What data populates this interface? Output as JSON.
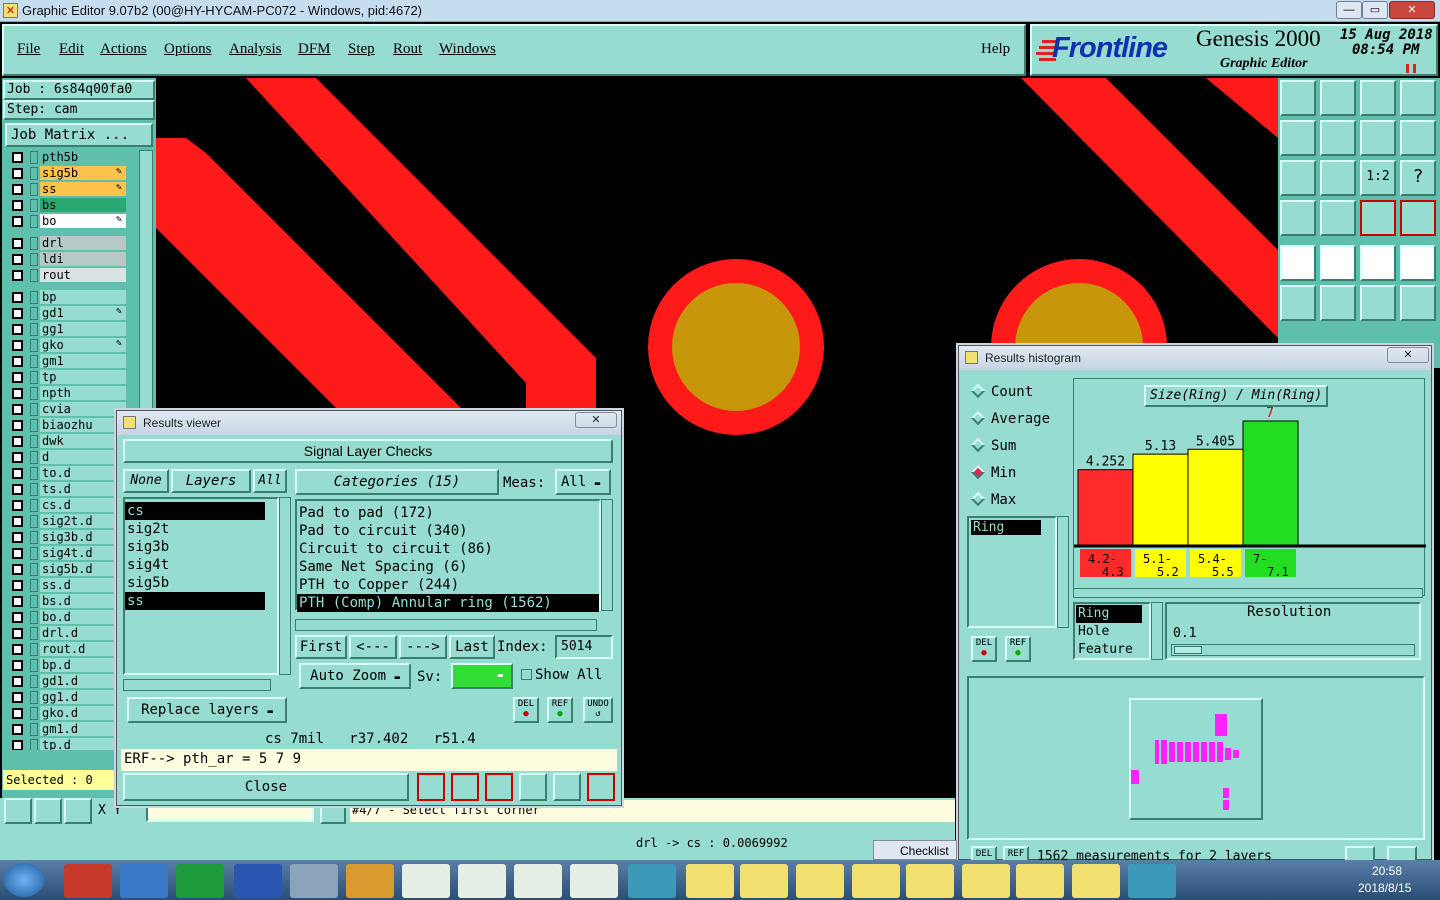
{
  "window": {
    "title": "Graphic Editor 9.07b2 (00@HY-HYCAM-PC072 - Windows, pid:4672)",
    "min": "—",
    "max": "▭",
    "close": "✕"
  },
  "menu": {
    "items": [
      "File",
      "Edit",
      "Actions",
      "Options",
      "Analysis",
      "DFM",
      "Step",
      "Rout",
      "Windows"
    ],
    "help": "Help"
  },
  "logo": {
    "brand": "Frontline",
    "product": "Genesis 2000",
    "subtitle": "Graphic Editor",
    "date": "15 Aug 2018",
    "time": "08:54 PM"
  },
  "job": {
    "job_label": "Job  :  6s84q00fa0",
    "step_label": "Step:  cam",
    "matrix_button": "Job Matrix ..."
  },
  "layers": [
    {
      "name": "pth5b",
      "color": "#5fbfad"
    },
    {
      "name": "sig5b",
      "color": "#ffc34d",
      "mark": "✎"
    },
    {
      "name": "ss",
      "color": "#ffc34d",
      "mark": "✎"
    },
    {
      "name": "bs",
      "color": "#2aa872"
    },
    {
      "name": "bo",
      "color": "#ffffff",
      "mark": "✎"
    },
    {
      "name": "drl",
      "color": "#b7c9c6"
    },
    {
      "name": "ldi",
      "color": "#b7c9c6"
    },
    {
      "name": "rout",
      "color": "#d9e3e1"
    },
    {
      "name": "bp",
      "color": "#96dcd0"
    },
    {
      "name": "gd1",
      "color": "#96dcd0",
      "mark": "✎"
    },
    {
      "name": "gg1",
      "color": "#96dcd0"
    },
    {
      "name": "gko",
      "color": "#96dcd0",
      "mark": "✎"
    },
    {
      "name": "gm1",
      "color": "#96dcd0"
    },
    {
      "name": "tp",
      "color": "#96dcd0"
    },
    {
      "name": "npth",
      "color": "#96dcd0"
    },
    {
      "name": "cvia",
      "color": "#96dcd0"
    },
    {
      "name": "biaozhu",
      "color": "#96dcd0"
    },
    {
      "name": "dwk",
      "color": "#96dcd0"
    },
    {
      "name": "d",
      "color": "#96dcd0"
    },
    {
      "name": "to.d",
      "color": "#96dcd0"
    },
    {
      "name": "ts.d",
      "color": "#96dcd0"
    },
    {
      "name": "cs.d",
      "color": "#96dcd0"
    },
    {
      "name": "sig2t.d",
      "color": "#96dcd0"
    },
    {
      "name": "sig3b.d",
      "color": "#96dcd0"
    },
    {
      "name": "sig4t.d",
      "color": "#96dcd0"
    },
    {
      "name": "sig5b.d",
      "color": "#96dcd0"
    },
    {
      "name": "ss.d",
      "color": "#96dcd0"
    },
    {
      "name": "bs.d",
      "color": "#96dcd0"
    },
    {
      "name": "bo.d",
      "color": "#96dcd0"
    },
    {
      "name": "drl.d",
      "color": "#96dcd0"
    },
    {
      "name": "rout.d",
      "color": "#96dcd0"
    },
    {
      "name": "bp.d",
      "color": "#96dcd0"
    },
    {
      "name": "gd1.d",
      "color": "#96dcd0"
    },
    {
      "name": "gg1.d",
      "color": "#96dcd0"
    },
    {
      "name": "gko.d",
      "color": "#96dcd0"
    },
    {
      "name": "gm1.d",
      "color": "#96dcd0"
    },
    {
      "name": "tp.d",
      "color": "#96dcd0"
    }
  ],
  "selected": "Selected : 0",
  "status": {
    "xy": "X Y",
    "prompt": "#4/7 - Select first corner",
    "measure": "drl -> cs : 0.0069992"
  },
  "results_viewer": {
    "title": "Results viewer",
    "header": "Signal Layer Checks",
    "none": "None",
    "layers": "Layers",
    "all": "All",
    "categories": "Categories (15)",
    "meas_label": "Meas:",
    "meas_value": "All",
    "layer_list": [
      "cs",
      "sig2t",
      "sig3b",
      "sig4t",
      "sig5b",
      "ss"
    ],
    "category_list": [
      "Pad to pad (172)",
      "Pad to circuit (340)",
      "Circuit to circuit (86)",
      "Same Net Spacing (6)",
      "PTH to Copper (244)",
      "PTH (Comp) Annular ring (1562)"
    ],
    "first": "First",
    "prev": "<---",
    "next": "--->",
    "last": "Last",
    "index_label": "Index:",
    "index_value": "5014",
    "auto_zoom": "Auto Zoom",
    "sv_label": "Sv:",
    "show_all": "Show All",
    "replace_layers": "Replace layers",
    "del": "DEL",
    "ref": "REF",
    "undo": "UNDO",
    "info": "cs 7mil   r37.402   r51.4",
    "erf": "ERF--> pth_ar = 5 7 9",
    "close": "Close"
  },
  "histogram": {
    "title": "Results histogram",
    "options": [
      "Count",
      "Average",
      "Sum",
      "Min",
      "Max"
    ],
    "selected_option": "Min",
    "chart_title": "Size(Ring) / Min(Ring)",
    "ring_list": [
      "Ring"
    ],
    "del": "DEL",
    "ref": "REF",
    "feature_list": [
      "Ring",
      "Hole",
      "Feature"
    ],
    "resolution_label": "Resolution",
    "resolution_value": "0.1",
    "footer": "1562 measurements for 2 layers"
  },
  "chart_data": {
    "type": "bar",
    "title": "Size(Ring) / Min(Ring)",
    "categories": [
      "4.2-4.3",
      "5.1-5.2",
      "5.4-5.5",
      "7-7.1"
    ],
    "values": [
      4.252,
      5.13,
      5.405,
      7
    ],
    "value_labels": [
      "4.252",
      "5.13",
      "5.405",
      "7"
    ],
    "colors": [
      "#ff2a2a",
      "#ffff00",
      "#ffff00",
      "#22dd22"
    ]
  },
  "checklist": "Checklist",
  "taskbar": {
    "time": "20:58",
    "date": "2018/8/15"
  }
}
